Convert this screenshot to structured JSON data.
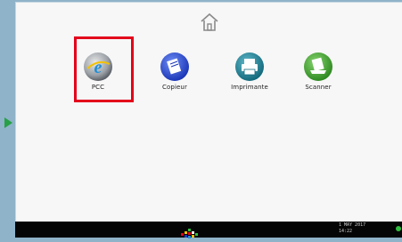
{
  "apps": [
    {
      "key": "pcc",
      "label": "PCC",
      "icon": "internet-explorer-e-icon"
    },
    {
      "key": "copieur",
      "label": "Copieur",
      "icon": "copier-icon"
    },
    {
      "key": "imprimante",
      "label": "Imprimante",
      "icon": "printer-icon"
    },
    {
      "key": "scanner",
      "label": "Scanner",
      "icon": "scanner-icon"
    }
  ],
  "home": {
    "icon": "home-icon"
  },
  "taskbar": {
    "date": "1 MAY  2017",
    "time": "14:22",
    "app_switch_icon": "app-list-icon",
    "status_icon": "status-indicator-icon"
  },
  "annotations": {
    "highlight_color": "#e3001b",
    "pointer_color": "#27a046"
  }
}
